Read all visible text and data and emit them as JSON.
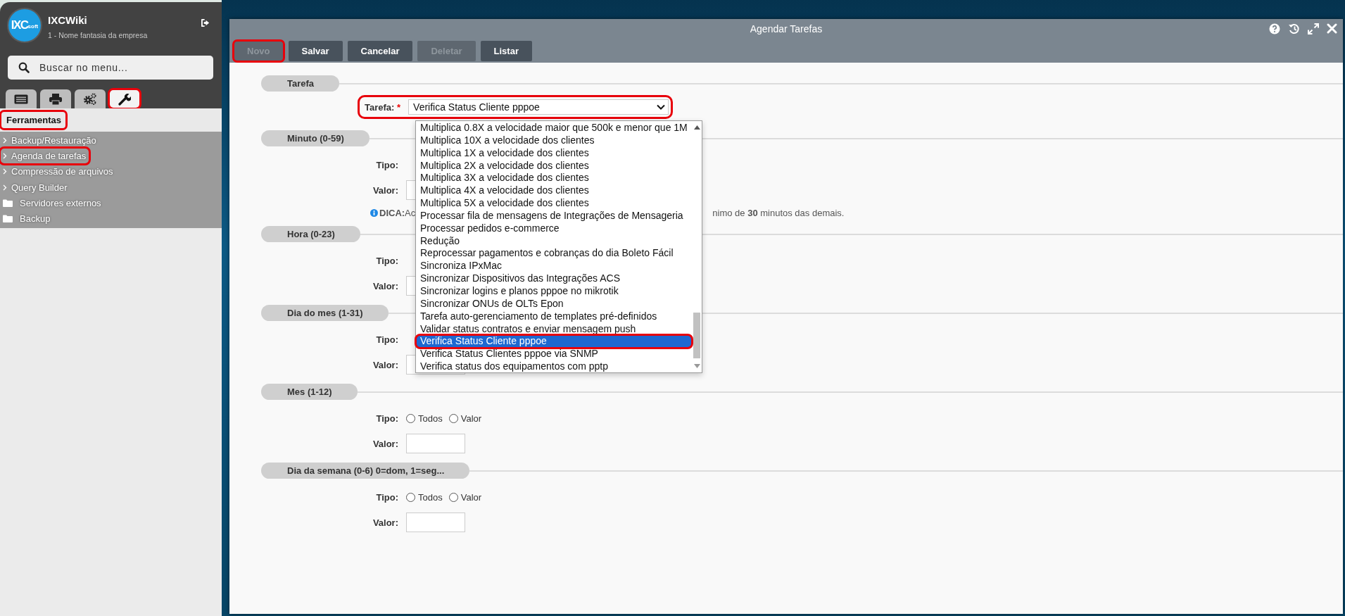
{
  "sidebar": {
    "logo": {
      "main": "IXC",
      "sub": "soft"
    },
    "brand": "IXCWiki",
    "company": "1 - Nome fantasia da empresa",
    "search": {
      "placeholder": "Buscar no menu..."
    },
    "tabs": [
      {
        "kind": "list",
        "selected": false,
        "highlighted": false
      },
      {
        "kind": "print",
        "selected": false,
        "highlighted": false
      },
      {
        "kind": "gears",
        "selected": false,
        "highlighted": false
      },
      {
        "kind": "wrench",
        "selected": true,
        "highlighted": true
      }
    ],
    "heading": {
      "title": "Ferramentas",
      "highlighted": true
    },
    "items": [
      {
        "kind": "link",
        "label": "Backup/Restauração",
        "highlighted": false
      },
      {
        "kind": "link",
        "label": "Agenda de tarefas",
        "highlighted": true
      },
      {
        "kind": "link",
        "label": "Compressão de arquivos",
        "highlighted": false
      },
      {
        "kind": "link",
        "label": "Query Builder",
        "highlighted": false
      },
      {
        "kind": "folder",
        "label": "Servidores externos",
        "highlighted": false
      },
      {
        "kind": "folder",
        "label": "Backup",
        "highlighted": false
      }
    ]
  },
  "window": {
    "title": "Agendar Tarefas",
    "toolbar": [
      {
        "label": "Novo",
        "disabled": true,
        "highlighted": true
      },
      {
        "label": "Salvar",
        "disabled": false,
        "highlighted": false
      },
      {
        "label": "Cancelar",
        "disabled": false,
        "highlighted": false
      },
      {
        "label": "Deletar",
        "disabled": true,
        "highlighted": false
      },
      {
        "label": "Listar",
        "disabled": false,
        "highlighted": false
      }
    ]
  },
  "form": {
    "sections": [
      {
        "kind": "select",
        "title": "Tarefa",
        "label": "Tarefa:",
        "required": "*",
        "value": "Verifica Status Cliente pppoe",
        "highlighted": true
      },
      {
        "kind": "schedule",
        "title": "Minuto (0-59)",
        "tipo_label": "Tipo:",
        "valor_label": "Valor:",
        "tip": {
          "label": "DICA:",
          "start": "Ac",
          "end": "nimo de **30** minutos das demais."
        }
      },
      {
        "kind": "schedule",
        "title": "Hora (0-23)",
        "tipo_label": "Tipo:",
        "valor_label": "Valor:"
      },
      {
        "kind": "schedule",
        "title": "Dia do mes (1-31)",
        "tipo_label": "Tipo:",
        "valor_label": "Valor:"
      },
      {
        "kind": "schedule",
        "title": "Mes (1-12)",
        "tipo_label": "Tipo:",
        "valor_label": "Valor:",
        "options": [
          {
            "label": "Todos",
            "checked": false
          },
          {
            "label": "Valor",
            "checked": false
          }
        ]
      },
      {
        "kind": "schedule",
        "title": "Dia da semana (0-6) 0=dom, 1=seg...",
        "tipo_label": "Tipo:",
        "valor_label": "Valor:",
        "options": [
          {
            "label": "Todos",
            "checked": false
          },
          {
            "label": "Valor",
            "checked": false
          }
        ]
      }
    ]
  },
  "dropdown": {
    "options": [
      {
        "label": "Multiplica 0.8X a velocidade maior que 500k e menor que 1M",
        "selected": false,
        "highlighted": false
      },
      {
        "label": "Multiplica 10X a velocidade dos clientes",
        "selected": false,
        "highlighted": false
      },
      {
        "label": "Multiplica 1X a velocidade dos clientes",
        "selected": false,
        "highlighted": false
      },
      {
        "label": "Multiplica 2X a velocidade dos clientes",
        "selected": false,
        "highlighted": false
      },
      {
        "label": "Multiplica 3X a velocidade dos clientes",
        "selected": false,
        "highlighted": false
      },
      {
        "label": "Multiplica 4X a velocidade dos clientes",
        "selected": false,
        "highlighted": false
      },
      {
        "label": "Multiplica 5X a velocidade dos clientes",
        "selected": false,
        "highlighted": false
      },
      {
        "label": "Processar fila de mensagens de Integrações de Mensageria",
        "selected": false,
        "highlighted": false
      },
      {
        "label": "Processar pedidos e-commerce",
        "selected": false,
        "highlighted": false
      },
      {
        "label": "Redução",
        "selected": false,
        "highlighted": false
      },
      {
        "label": "Reprocessar pagamentos e cobranças do dia Boleto Fácil",
        "selected": false,
        "highlighted": false
      },
      {
        "label": "Sincroniza IPxMac",
        "selected": false,
        "highlighted": false
      },
      {
        "label": "Sincronizar Dispositivos das Integrações ACS",
        "selected": false,
        "highlighted": false
      },
      {
        "label": "Sincronizar logins e planos pppoe no mikrotik",
        "selected": false,
        "highlighted": false
      },
      {
        "label": "Sincronizar ONUs de OLTs Epon",
        "selected": false,
        "highlighted": false
      },
      {
        "label": "Tarefa auto-gerenciamento de templates pré-definidos",
        "selected": false,
        "highlighted": false
      },
      {
        "label": "Validar status contratos e enviar mensagem push",
        "selected": false,
        "highlighted": false
      },
      {
        "label": "Verifica Status Cliente pppoe",
        "selected": true,
        "highlighted": true
      },
      {
        "label": "Verifica Status Clientes pppoe via SNMP",
        "selected": false,
        "highlighted": false
      },
      {
        "label": "Verifica status dos equipamentos com pptp",
        "selected": false,
        "highlighted": false
      }
    ]
  }
}
